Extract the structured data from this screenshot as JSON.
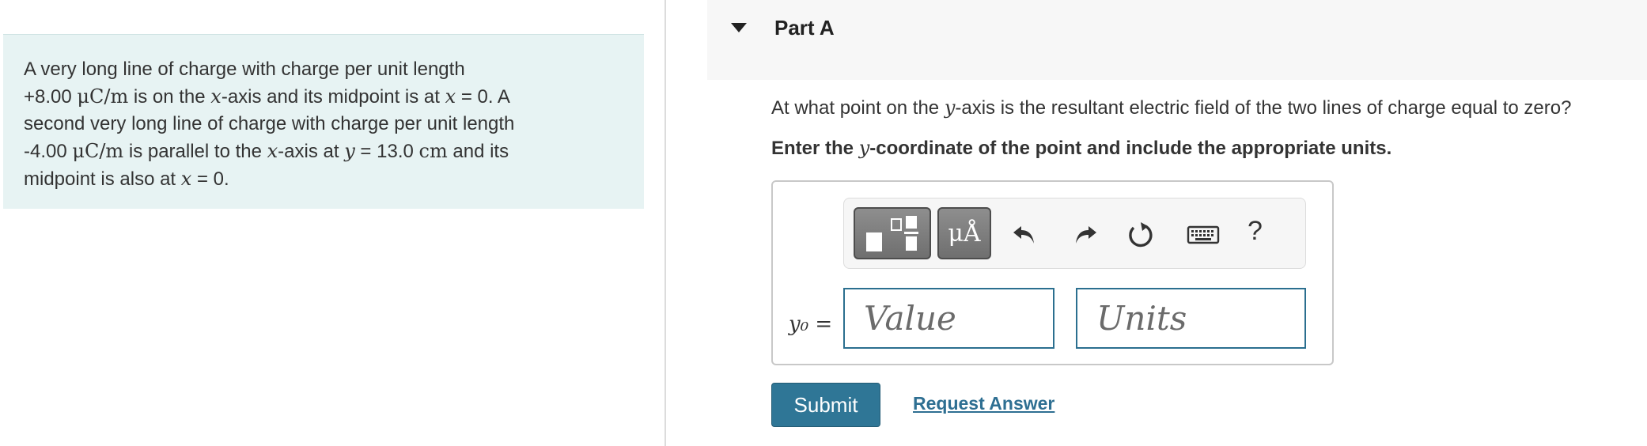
{
  "problem": {
    "t1": "A very long line of charge with charge per unit length",
    "t2a": "+8.00 ",
    "t2_unit": "μC/m",
    "t2b": " is on the ",
    "var_x": "x",
    "t2c": "-axis and its midpoint is at ",
    "t2d": " = 0. A",
    "t3": "second very long line of charge with charge per unit length",
    "t4a": "-4.00 ",
    "t4_unit": "μC/m",
    "t4b": " is parallel to the ",
    "t4c": "-axis at ",
    "var_y": "y",
    "t4d": " = 13.0 ",
    "t4_cm": "cm",
    "t4e": " and its",
    "t5a": "midpoint is also at ",
    "t5b": " = 0."
  },
  "part": {
    "title": "Part A",
    "question_pre": "At what point on the ",
    "question_var": "y",
    "question_post": "-axis is the resultant electric field of the two lines of charge equal to zero?",
    "instruction_pre": "Enter the ",
    "instruction_var": "y",
    "instruction_post": "-coordinate of the point and include the appropriate units."
  },
  "toolbar": {
    "units_glyph": "μÅ",
    "help_glyph": "?"
  },
  "answer": {
    "label": "y₀ =",
    "value_placeholder": "Value",
    "units_placeholder": "Units",
    "value": "",
    "units": ""
  },
  "actions": {
    "submit_label": "Submit",
    "request_label": "Request Answer"
  },
  "colors": {
    "problem_bg": "#e7f3f3",
    "accent": "#2f7696",
    "link": "#2e6f92"
  },
  "icons": [
    "caret-down-icon",
    "fraction-template-icon",
    "units-icon",
    "undo-icon",
    "redo-icon",
    "reset-icon",
    "keyboard-icon",
    "help-icon"
  ]
}
